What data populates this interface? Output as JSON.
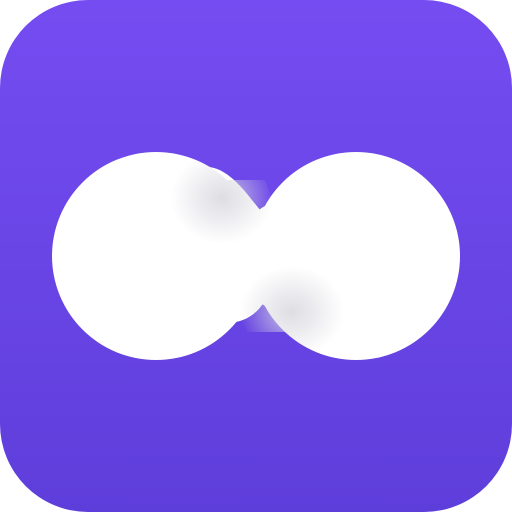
{
  "app_icon": {
    "icon": "infinity-icon",
    "colors": {
      "background_top": "#754CF1",
      "background_bottom": "#5E3EDB",
      "glyph": "#FFFFFF",
      "glyph_shadow": "#D9D9E0"
    }
  }
}
